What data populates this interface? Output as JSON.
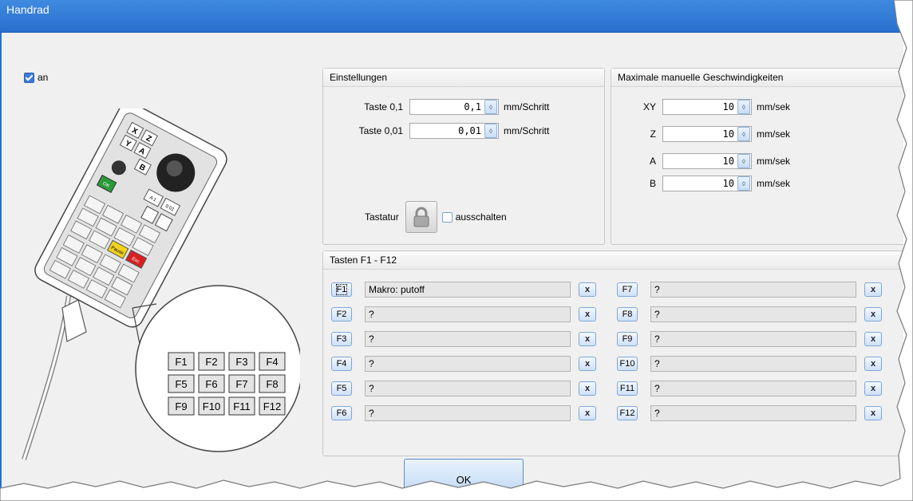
{
  "window": {
    "title": "Handrad"
  },
  "enable": {
    "label": "an",
    "checked": true
  },
  "settings": {
    "title": "Einstellungen",
    "rows": [
      {
        "label": "Taste 0,1",
        "value": "0,1",
        "unit": "mm/Schritt"
      },
      {
        "label": "Taste 0,01",
        "value": "0,01",
        "unit": "mm/Schritt"
      }
    ],
    "keyboard_label": "Tastatur",
    "disable_label": "ausschalten"
  },
  "speeds": {
    "title": "Maximale manuelle Geschwindigkeiten",
    "rows": [
      {
        "label": "XY",
        "value": "10",
        "unit": "mm/sek"
      },
      {
        "label": "Z",
        "value": "10",
        "unit": "mm/sek"
      },
      {
        "label": "A",
        "value": "10",
        "unit": "mm/sek"
      },
      {
        "label": "B",
        "value": "10",
        "unit": "mm/sek"
      }
    ]
  },
  "fkeys": {
    "title": "Tasten F1 - F12",
    "left": [
      {
        "key": "F1",
        "value": "Makro: putoff"
      },
      {
        "key": "F2",
        "value": "?"
      },
      {
        "key": "F3",
        "value": "?"
      },
      {
        "key": "F4",
        "value": "?"
      },
      {
        "key": "F5",
        "value": "?"
      },
      {
        "key": "F6",
        "value": "?"
      }
    ],
    "right": [
      {
        "key": "F7",
        "value": "?"
      },
      {
        "key": "F8",
        "value": "?"
      },
      {
        "key": "F9",
        "value": "?"
      },
      {
        "key": "F10",
        "value": "?"
      },
      {
        "key": "F11",
        "value": "?"
      },
      {
        "key": "F12",
        "value": "?"
      }
    ],
    "clear_label": "x"
  },
  "pendant": {
    "axis_keys": [
      "X",
      "Z",
      "Y",
      "A",
      "B"
    ],
    "small_keys": [
      "A 1",
      "0.01"
    ],
    "ok_key": "OK",
    "yellow_key": "Pause",
    "red_key": "Esc",
    "callout_keys": [
      "F1",
      "F2",
      "F3",
      "F4",
      "F5",
      "F6",
      "F7",
      "F8",
      "F9",
      "F10",
      "F11",
      "F12"
    ]
  },
  "footer": {
    "ok_label": "OK"
  },
  "colors": {
    "title_bar": "#2a6fcd",
    "button_face": "#cfe0f6",
    "field_bg": "#e6e6e6"
  }
}
